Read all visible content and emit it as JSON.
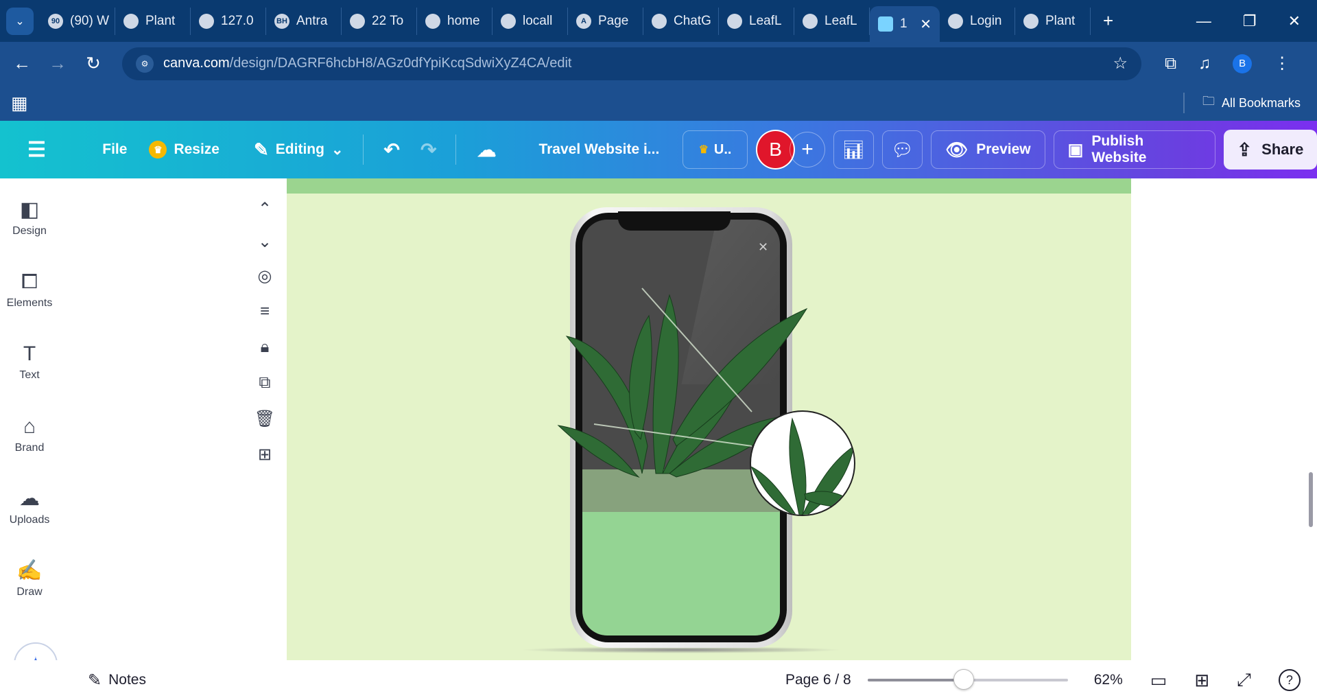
{
  "browser": {
    "tabs": [
      {
        "label": "(90) W",
        "icon": "whatsapp-icon",
        "badge": "90"
      },
      {
        "label": "Plant",
        "icon": "github-icon"
      },
      {
        "label": "127.0",
        "icon": "globe-icon"
      },
      {
        "label": "Antra",
        "icon": "bh-icon",
        "badge": "BH"
      },
      {
        "label": "22 To",
        "icon": "home-icon"
      },
      {
        "label": "home",
        "icon": "globe-icon"
      },
      {
        "label": "locall",
        "icon": "logo-icon"
      },
      {
        "label": "Page",
        "icon": "a-icon",
        "badge": "A"
      },
      {
        "label": "ChatG",
        "icon": "openai-icon"
      },
      {
        "label": "LeafL",
        "icon": "figma-icon"
      },
      {
        "label": "LeafL",
        "icon": "figma-icon"
      },
      {
        "label": "1",
        "icon": "canva-icon",
        "active": true
      },
      {
        "label": "Login",
        "icon": "globe-icon"
      },
      {
        "label": "Plant",
        "icon": "globe-icon"
      }
    ],
    "url_host": "canva.com",
    "url_path": "/design/DAGRF6hcbH8/AGz0dfYpiKcqSdwiXyZ4CA/edit",
    "profile_initial": "B",
    "bookmarks_label": "All Bookmarks"
  },
  "canva": {
    "file": "File",
    "resize": "Resize",
    "editing": "Editing",
    "doc_title": "Travel Website i...",
    "upgrade_label": "U..",
    "avatar_initial": "B",
    "preview": "Preview",
    "publish": "Publish Website",
    "share": "Share",
    "brand_avatar_color": "#e0162b"
  },
  "sidebar": {
    "items": [
      {
        "label": "Design",
        "icon": "design-icon"
      },
      {
        "label": "Elements",
        "icon": "elements-icon"
      },
      {
        "label": "Text",
        "icon": "text-icon"
      },
      {
        "label": "Brand",
        "icon": "brand-icon"
      },
      {
        "label": "Uploads",
        "icon": "uploads-icon"
      },
      {
        "label": "Draw",
        "icon": "draw-icon"
      }
    ]
  },
  "footer": {
    "notes": "Notes",
    "page": "Page 6 / 8",
    "zoom": "62%",
    "zoom_fraction": 0.48
  },
  "canvas": {
    "background": "#e4f3c9",
    "band_color": "#9bd48f",
    "screen_green": "#94d493"
  }
}
